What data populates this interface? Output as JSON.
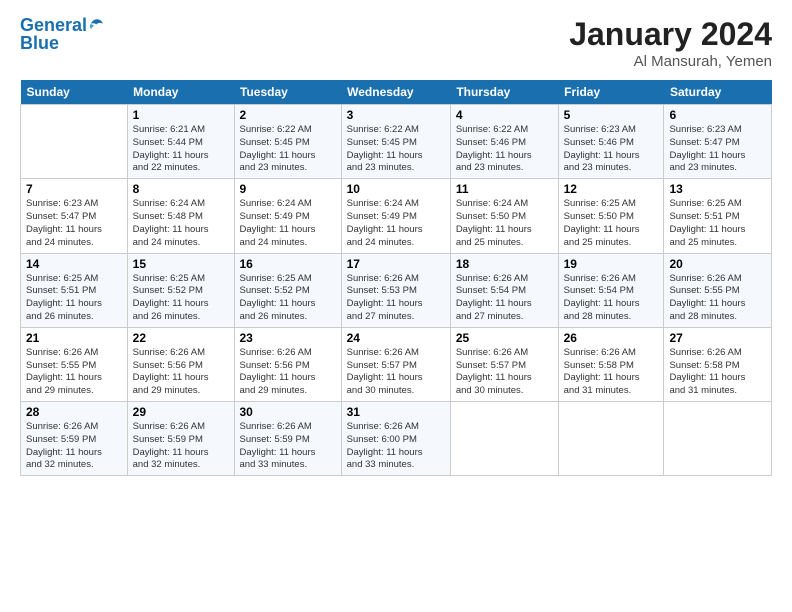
{
  "logo": {
    "line1": "General",
    "line2": "Blue"
  },
  "title": "January 2024",
  "subtitle": "Al Mansurah, Yemen",
  "columns": [
    "Sunday",
    "Monday",
    "Tuesday",
    "Wednesday",
    "Thursday",
    "Friday",
    "Saturday"
  ],
  "weeks": [
    [
      {
        "num": "",
        "info": ""
      },
      {
        "num": "1",
        "info": "Sunrise: 6:21 AM\nSunset: 5:44 PM\nDaylight: 11 hours\nand 22 minutes."
      },
      {
        "num": "2",
        "info": "Sunrise: 6:22 AM\nSunset: 5:45 PM\nDaylight: 11 hours\nand 23 minutes."
      },
      {
        "num": "3",
        "info": "Sunrise: 6:22 AM\nSunset: 5:45 PM\nDaylight: 11 hours\nand 23 minutes."
      },
      {
        "num": "4",
        "info": "Sunrise: 6:22 AM\nSunset: 5:46 PM\nDaylight: 11 hours\nand 23 minutes."
      },
      {
        "num": "5",
        "info": "Sunrise: 6:23 AM\nSunset: 5:46 PM\nDaylight: 11 hours\nand 23 minutes."
      },
      {
        "num": "6",
        "info": "Sunrise: 6:23 AM\nSunset: 5:47 PM\nDaylight: 11 hours\nand 23 minutes."
      }
    ],
    [
      {
        "num": "7",
        "info": "Sunrise: 6:23 AM\nSunset: 5:47 PM\nDaylight: 11 hours\nand 24 minutes."
      },
      {
        "num": "8",
        "info": "Sunrise: 6:24 AM\nSunset: 5:48 PM\nDaylight: 11 hours\nand 24 minutes."
      },
      {
        "num": "9",
        "info": "Sunrise: 6:24 AM\nSunset: 5:49 PM\nDaylight: 11 hours\nand 24 minutes."
      },
      {
        "num": "10",
        "info": "Sunrise: 6:24 AM\nSunset: 5:49 PM\nDaylight: 11 hours\nand 24 minutes."
      },
      {
        "num": "11",
        "info": "Sunrise: 6:24 AM\nSunset: 5:50 PM\nDaylight: 11 hours\nand 25 minutes."
      },
      {
        "num": "12",
        "info": "Sunrise: 6:25 AM\nSunset: 5:50 PM\nDaylight: 11 hours\nand 25 minutes."
      },
      {
        "num": "13",
        "info": "Sunrise: 6:25 AM\nSunset: 5:51 PM\nDaylight: 11 hours\nand 25 minutes."
      }
    ],
    [
      {
        "num": "14",
        "info": "Sunrise: 6:25 AM\nSunset: 5:51 PM\nDaylight: 11 hours\nand 26 minutes."
      },
      {
        "num": "15",
        "info": "Sunrise: 6:25 AM\nSunset: 5:52 PM\nDaylight: 11 hours\nand 26 minutes."
      },
      {
        "num": "16",
        "info": "Sunrise: 6:25 AM\nSunset: 5:52 PM\nDaylight: 11 hours\nand 26 minutes."
      },
      {
        "num": "17",
        "info": "Sunrise: 6:26 AM\nSunset: 5:53 PM\nDaylight: 11 hours\nand 27 minutes."
      },
      {
        "num": "18",
        "info": "Sunrise: 6:26 AM\nSunset: 5:54 PM\nDaylight: 11 hours\nand 27 minutes."
      },
      {
        "num": "19",
        "info": "Sunrise: 6:26 AM\nSunset: 5:54 PM\nDaylight: 11 hours\nand 28 minutes."
      },
      {
        "num": "20",
        "info": "Sunrise: 6:26 AM\nSunset: 5:55 PM\nDaylight: 11 hours\nand 28 minutes."
      }
    ],
    [
      {
        "num": "21",
        "info": "Sunrise: 6:26 AM\nSunset: 5:55 PM\nDaylight: 11 hours\nand 29 minutes."
      },
      {
        "num": "22",
        "info": "Sunrise: 6:26 AM\nSunset: 5:56 PM\nDaylight: 11 hours\nand 29 minutes."
      },
      {
        "num": "23",
        "info": "Sunrise: 6:26 AM\nSunset: 5:56 PM\nDaylight: 11 hours\nand 29 minutes."
      },
      {
        "num": "24",
        "info": "Sunrise: 6:26 AM\nSunset: 5:57 PM\nDaylight: 11 hours\nand 30 minutes."
      },
      {
        "num": "25",
        "info": "Sunrise: 6:26 AM\nSunset: 5:57 PM\nDaylight: 11 hours\nand 30 minutes."
      },
      {
        "num": "26",
        "info": "Sunrise: 6:26 AM\nSunset: 5:58 PM\nDaylight: 11 hours\nand 31 minutes."
      },
      {
        "num": "27",
        "info": "Sunrise: 6:26 AM\nSunset: 5:58 PM\nDaylight: 11 hours\nand 31 minutes."
      }
    ],
    [
      {
        "num": "28",
        "info": "Sunrise: 6:26 AM\nSunset: 5:59 PM\nDaylight: 11 hours\nand 32 minutes."
      },
      {
        "num": "29",
        "info": "Sunrise: 6:26 AM\nSunset: 5:59 PM\nDaylight: 11 hours\nand 32 minutes."
      },
      {
        "num": "30",
        "info": "Sunrise: 6:26 AM\nSunset: 5:59 PM\nDaylight: 11 hours\nand 33 minutes."
      },
      {
        "num": "31",
        "info": "Sunrise: 6:26 AM\nSunset: 6:00 PM\nDaylight: 11 hours\nand 33 minutes."
      },
      {
        "num": "",
        "info": ""
      },
      {
        "num": "",
        "info": ""
      },
      {
        "num": "",
        "info": ""
      }
    ]
  ]
}
